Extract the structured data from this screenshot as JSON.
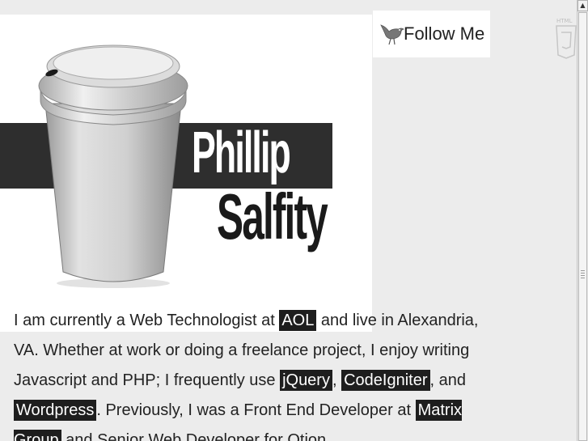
{
  "header": {
    "name_first": "Phillip",
    "name_last": "Salfity"
  },
  "follow": {
    "label": "Follow Me",
    "icon": "bird-icon"
  },
  "bio": {
    "part1": "I am currently a Web Technologist at ",
    "link_aol": "AOL",
    "part2": " and live in Alexandria, VA. Whether at work or doing a freelance project, I enjoy writing Javascript and PHP; I frequently use ",
    "link_jquery": "jQuery",
    "part3": ", ",
    "link_codeigniter": "CodeIgniter",
    "part4": ", and ",
    "link_wordpress": "Wordpress",
    "part5": ". Previously, I was a Front End Developer at ",
    "link_matrix": "Matrix Group",
    "part6": " and Senior Web Developer for Otion"
  },
  "colors": {
    "background": "#ececec",
    "band": "#2e2e2e",
    "highlight": "#1e1e1e"
  }
}
